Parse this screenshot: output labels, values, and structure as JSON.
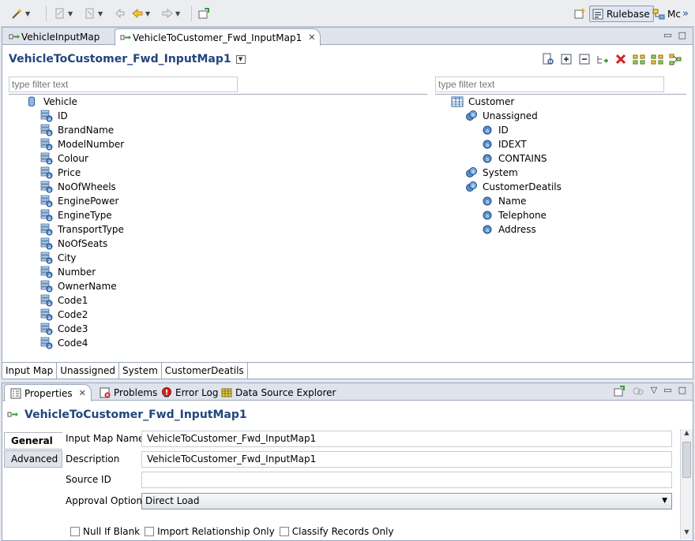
{
  "toolbar": {
    "perspectives": [
      {
        "label": "Rulebase",
        "active": true
      },
      {
        "label": "Mc",
        "active": false
      }
    ],
    "overflow": "»"
  },
  "editor": {
    "tabs": [
      {
        "label": "VehicleInputMap",
        "active": false
      },
      {
        "label": "VehicleToCustomer_Fwd_InputMap1",
        "active": true,
        "close": "✕"
      }
    ],
    "title": "VehicleToCustomer_Fwd_InputMap1",
    "left_filter_placeholder": "type filter text",
    "right_filter_placeholder": "type filter text",
    "left_tree": {
      "root": "Vehicle",
      "children": [
        "ID",
        "BrandName",
        "ModelNumber",
        "Colour",
        "Price",
        "NoOfWheels",
        "EnginePower",
        "EngineType",
        "TransportType",
        "NoOfSeats",
        "City",
        "Number",
        "OwnerName",
        "Code1",
        "Code2",
        "Code3",
        "Code4"
      ]
    },
    "right_tree": {
      "root": "Customer",
      "groups": [
        {
          "label": "Unassigned",
          "children": [
            "ID",
            "IDEXT",
            "CONTAINS"
          ]
        },
        {
          "label": "System",
          "children": []
        },
        {
          "label": "CustomerDeatils",
          "children": [
            "Name",
            "Telephone",
            "Address"
          ]
        }
      ]
    },
    "bottom_tabs": [
      "Input Map",
      "Unassigned",
      "System",
      "CustomerDeatils"
    ]
  },
  "properties": {
    "tabs": [
      {
        "label": "Properties",
        "active": true,
        "close": "✕"
      },
      {
        "label": "Problems"
      },
      {
        "label": "Error Log"
      },
      {
        "label": "Data Source Explorer"
      }
    ],
    "title": "VehicleToCustomer_Fwd_InputMap1",
    "side_tabs": [
      {
        "label": "General",
        "active": true
      },
      {
        "label": "Advanced",
        "active": false
      }
    ],
    "fields": {
      "input_map_name_label": "Input Map Name",
      "input_map_name_value": "VehicleToCustomer_Fwd_InputMap1",
      "description_label": "Description",
      "description_value": "VehicleToCustomer_Fwd_InputMap1",
      "source_id_label": "Source ID",
      "source_id_value": "",
      "approval_option_label": "Approval Option",
      "approval_option_value": "Direct Load"
    },
    "checkboxes": [
      "Null If Blank",
      "Import Relationship Only",
      "Classify Records Only"
    ]
  },
  "colors": {
    "title_blue": "#22457d",
    "accent_green": "#3b9a3b",
    "delete_red": "#d62020"
  }
}
